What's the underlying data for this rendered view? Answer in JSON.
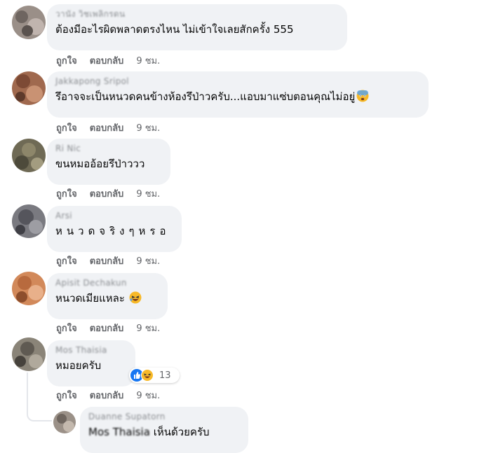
{
  "colors": {
    "bubble": "#f0f2f5",
    "text": "#050505",
    "secondary": "#65676b",
    "like_blue": "#1877f2",
    "haha_yellow": "#f7b928"
  },
  "actions": {
    "like": "ถูกใจ",
    "reply": "ตอบกลับ"
  },
  "comments": [
    {
      "author": "วานัง วิชเพลิกรดน",
      "text": "ต้องมีอะไรผิดพลาดตรงไหน ไม่เข้าใจเลยสักครั้ง 555",
      "time": "9 ชม."
    },
    {
      "author": "Jakkapong Sripol",
      "text": "รึอาจจะเป็นหนวดคนข้างห้องรึป่าวครับ...แอบมาแซ่บตอนคุณไม่อยู่",
      "emoji": "fearful-face-icon",
      "time": "9 ชม."
    },
    {
      "author": "Ri Nic",
      "text": "ขนหมออ้อยรึป่าววว",
      "time": "9 ชม."
    },
    {
      "author": "Arsi",
      "text": "หนวดจริงๆหรอ",
      "time": "9 ชม."
    },
    {
      "author": "Apisit Dechakun",
      "text": "หนวดเมียแหละ",
      "emoji": "laughing-face-icon",
      "time": "9 ชม."
    },
    {
      "author": "Mos Thaisia",
      "text": "หมอยครับ",
      "time": "9 ชม.",
      "reaction_count": "13"
    }
  ],
  "reply": {
    "author": "Duanne Supatorn",
    "mention": "Mos Thaisia",
    "text": "เห็นด้วยครับ"
  }
}
